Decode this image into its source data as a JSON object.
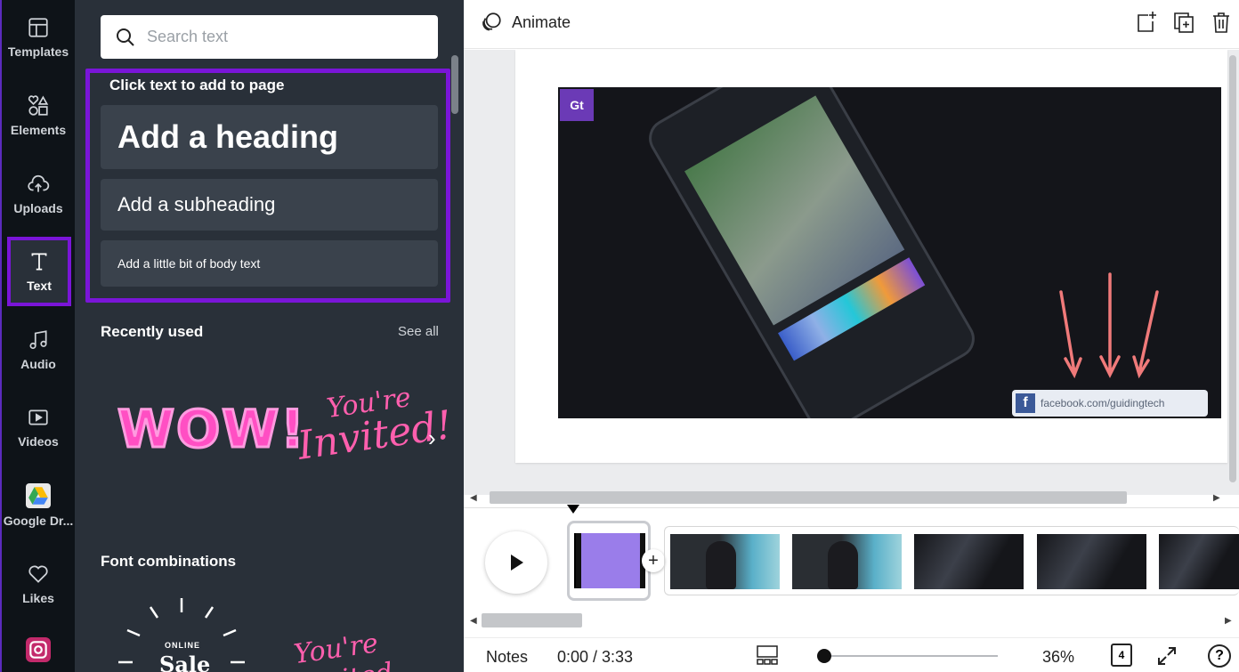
{
  "rail": {
    "items": [
      {
        "label": "Templates",
        "icon": "templates-icon"
      },
      {
        "label": "Elements",
        "icon": "elements-icon"
      },
      {
        "label": "Uploads",
        "icon": "upload-cloud-icon"
      },
      {
        "label": "Text",
        "icon": "text-icon"
      },
      {
        "label": "Audio",
        "icon": "music-note-icon"
      },
      {
        "label": "Videos",
        "icon": "video-icon"
      },
      {
        "label": "Google Dr...",
        "icon": "google-drive-icon"
      },
      {
        "label": "Likes",
        "icon": "heart-icon"
      },
      {
        "label": "",
        "icon": "instagram-icon"
      }
    ],
    "active": "Text"
  },
  "panel": {
    "search_placeholder": "Search text",
    "click_title": "Click text to add to page",
    "heading": "Add a heading",
    "subheading": "Add a subheading",
    "body": "Add a little bit of body text",
    "recently_used": "Recently used",
    "see_all": "See all",
    "wow": "WOW!",
    "invited_l1": "You're",
    "invited_l2": "Invited!",
    "font_combinations": "Font combinations",
    "sale_online": "ONLINE",
    "sale": "Sale",
    "invited2": "You're Invited"
  },
  "topbar": {
    "animate": "Animate"
  },
  "canvas": {
    "logo": "Gt",
    "fb_text": "facebook.com/guidingtech",
    "fb_letter": "f"
  },
  "bottombar": {
    "notes": "Notes",
    "time": "0:00 / 3:33",
    "zoom": "36%",
    "pages": "4",
    "help": "?"
  },
  "colors": {
    "accent": "#7a15d8",
    "panel_bg": "#293039",
    "rail_bg": "#0e1318",
    "arrow": "#f07a7a"
  }
}
